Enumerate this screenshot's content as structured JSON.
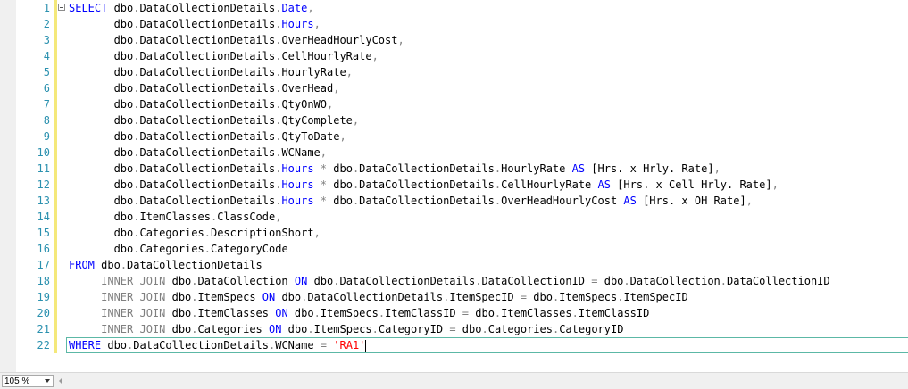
{
  "editor": {
    "lines": [
      {
        "n": "1",
        "tokens": [
          {
            "t": "SELECT",
            "c": "kw"
          },
          {
            "t": " dbo",
            "c": "id"
          },
          {
            "t": ".",
            "c": "op"
          },
          {
            "t": "DataCollectionDetails",
            "c": "id"
          },
          {
            "t": ".",
            "c": "op"
          },
          {
            "t": "Date",
            "c": "kw"
          },
          {
            "t": ",",
            "c": "op"
          }
        ]
      },
      {
        "n": "2",
        "tokens": [
          {
            "t": "       dbo",
            "c": "id"
          },
          {
            "t": ".",
            "c": "op"
          },
          {
            "t": "DataCollectionDetails",
            "c": "id"
          },
          {
            "t": ".",
            "c": "op"
          },
          {
            "t": "Hours",
            "c": "kw"
          },
          {
            "t": ",",
            "c": "op"
          }
        ]
      },
      {
        "n": "3",
        "tokens": [
          {
            "t": "       dbo",
            "c": "id"
          },
          {
            "t": ".",
            "c": "op"
          },
          {
            "t": "DataCollectionDetails",
            "c": "id"
          },
          {
            "t": ".",
            "c": "op"
          },
          {
            "t": "OverHeadHourlyCost",
            "c": "id"
          },
          {
            "t": ",",
            "c": "op"
          }
        ]
      },
      {
        "n": "4",
        "tokens": [
          {
            "t": "       dbo",
            "c": "id"
          },
          {
            "t": ".",
            "c": "op"
          },
          {
            "t": "DataCollectionDetails",
            "c": "id"
          },
          {
            "t": ".",
            "c": "op"
          },
          {
            "t": "CellHourlyRate",
            "c": "id"
          },
          {
            "t": ",",
            "c": "op"
          }
        ]
      },
      {
        "n": "5",
        "tokens": [
          {
            "t": "       dbo",
            "c": "id"
          },
          {
            "t": ".",
            "c": "op"
          },
          {
            "t": "DataCollectionDetails",
            "c": "id"
          },
          {
            "t": ".",
            "c": "op"
          },
          {
            "t": "HourlyRate",
            "c": "id"
          },
          {
            "t": ",",
            "c": "op"
          }
        ]
      },
      {
        "n": "6",
        "tokens": [
          {
            "t": "       dbo",
            "c": "id"
          },
          {
            "t": ".",
            "c": "op"
          },
          {
            "t": "DataCollectionDetails",
            "c": "id"
          },
          {
            "t": ".",
            "c": "op"
          },
          {
            "t": "OverHead",
            "c": "id"
          },
          {
            "t": ",",
            "c": "op"
          }
        ]
      },
      {
        "n": "7",
        "tokens": [
          {
            "t": "       dbo",
            "c": "id"
          },
          {
            "t": ".",
            "c": "op"
          },
          {
            "t": "DataCollectionDetails",
            "c": "id"
          },
          {
            "t": ".",
            "c": "op"
          },
          {
            "t": "QtyOnWO",
            "c": "id"
          },
          {
            "t": ",",
            "c": "op"
          }
        ]
      },
      {
        "n": "8",
        "tokens": [
          {
            "t": "       dbo",
            "c": "id"
          },
          {
            "t": ".",
            "c": "op"
          },
          {
            "t": "DataCollectionDetails",
            "c": "id"
          },
          {
            "t": ".",
            "c": "op"
          },
          {
            "t": "QtyComplete",
            "c": "id"
          },
          {
            "t": ",",
            "c": "op"
          }
        ]
      },
      {
        "n": "9",
        "tokens": [
          {
            "t": "       dbo",
            "c": "id"
          },
          {
            "t": ".",
            "c": "op"
          },
          {
            "t": "DataCollectionDetails",
            "c": "id"
          },
          {
            "t": ".",
            "c": "op"
          },
          {
            "t": "QtyToDate",
            "c": "id"
          },
          {
            "t": ",",
            "c": "op"
          }
        ]
      },
      {
        "n": "10",
        "tokens": [
          {
            "t": "       dbo",
            "c": "id"
          },
          {
            "t": ".",
            "c": "op"
          },
          {
            "t": "DataCollectionDetails",
            "c": "id"
          },
          {
            "t": ".",
            "c": "op"
          },
          {
            "t": "WCName",
            "c": "id"
          },
          {
            "t": ",",
            "c": "op"
          }
        ]
      },
      {
        "n": "11",
        "tokens": [
          {
            "t": "       dbo",
            "c": "id"
          },
          {
            "t": ".",
            "c": "op"
          },
          {
            "t": "DataCollectionDetails",
            "c": "id"
          },
          {
            "t": ".",
            "c": "op"
          },
          {
            "t": "Hours",
            "c": "kw"
          },
          {
            "t": " * ",
            "c": "op"
          },
          {
            "t": "dbo",
            "c": "id"
          },
          {
            "t": ".",
            "c": "op"
          },
          {
            "t": "DataCollectionDetails",
            "c": "id"
          },
          {
            "t": ".",
            "c": "op"
          },
          {
            "t": "HourlyRate ",
            "c": "id"
          },
          {
            "t": "AS",
            "c": "kw"
          },
          {
            "t": " [Hrs. x Hrly. Rate]",
            "c": "id"
          },
          {
            "t": ",",
            "c": "op"
          }
        ]
      },
      {
        "n": "12",
        "tokens": [
          {
            "t": "       dbo",
            "c": "id"
          },
          {
            "t": ".",
            "c": "op"
          },
          {
            "t": "DataCollectionDetails",
            "c": "id"
          },
          {
            "t": ".",
            "c": "op"
          },
          {
            "t": "Hours",
            "c": "kw"
          },
          {
            "t": " * ",
            "c": "op"
          },
          {
            "t": "dbo",
            "c": "id"
          },
          {
            "t": ".",
            "c": "op"
          },
          {
            "t": "DataCollectionDetails",
            "c": "id"
          },
          {
            "t": ".",
            "c": "op"
          },
          {
            "t": "CellHourlyRate ",
            "c": "id"
          },
          {
            "t": "AS",
            "c": "kw"
          },
          {
            "t": " [Hrs. x Cell Hrly. Rate]",
            "c": "id"
          },
          {
            "t": ",",
            "c": "op"
          }
        ]
      },
      {
        "n": "13",
        "tokens": [
          {
            "t": "       dbo",
            "c": "id"
          },
          {
            "t": ".",
            "c": "op"
          },
          {
            "t": "DataCollectionDetails",
            "c": "id"
          },
          {
            "t": ".",
            "c": "op"
          },
          {
            "t": "Hours",
            "c": "kw"
          },
          {
            "t": " * ",
            "c": "op"
          },
          {
            "t": "dbo",
            "c": "id"
          },
          {
            "t": ".",
            "c": "op"
          },
          {
            "t": "DataCollectionDetails",
            "c": "id"
          },
          {
            "t": ".",
            "c": "op"
          },
          {
            "t": "OverHeadHourlyCost ",
            "c": "id"
          },
          {
            "t": "AS",
            "c": "kw"
          },
          {
            "t": " [Hrs. x OH Rate]",
            "c": "id"
          },
          {
            "t": ",",
            "c": "op"
          }
        ]
      },
      {
        "n": "14",
        "tokens": [
          {
            "t": "       dbo",
            "c": "id"
          },
          {
            "t": ".",
            "c": "op"
          },
          {
            "t": "ItemClasses",
            "c": "id"
          },
          {
            "t": ".",
            "c": "op"
          },
          {
            "t": "ClassCode",
            "c": "id"
          },
          {
            "t": ",",
            "c": "op"
          }
        ]
      },
      {
        "n": "15",
        "tokens": [
          {
            "t": "       dbo",
            "c": "id"
          },
          {
            "t": ".",
            "c": "op"
          },
          {
            "t": "Categories",
            "c": "id"
          },
          {
            "t": ".",
            "c": "op"
          },
          {
            "t": "DescriptionShort",
            "c": "id"
          },
          {
            "t": ",",
            "c": "op"
          }
        ]
      },
      {
        "n": "16",
        "tokens": [
          {
            "t": "       dbo",
            "c": "id"
          },
          {
            "t": ".",
            "c": "op"
          },
          {
            "t": "Categories",
            "c": "id"
          },
          {
            "t": ".",
            "c": "op"
          },
          {
            "t": "CategoryCode",
            "c": "id"
          }
        ]
      },
      {
        "n": "17",
        "tokens": [
          {
            "t": "FROM",
            "c": "kw"
          },
          {
            "t": " dbo",
            "c": "id"
          },
          {
            "t": ".",
            "c": "op"
          },
          {
            "t": "DataCollectionDetails",
            "c": "id"
          }
        ]
      },
      {
        "n": "18",
        "tokens": [
          {
            "t": "     INNER JOIN",
            "c": "op"
          },
          {
            "t": " dbo",
            "c": "id"
          },
          {
            "t": ".",
            "c": "op"
          },
          {
            "t": "DataCollection ",
            "c": "id"
          },
          {
            "t": "ON",
            "c": "kw"
          },
          {
            "t": " dbo",
            "c": "id"
          },
          {
            "t": ".",
            "c": "op"
          },
          {
            "t": "DataCollectionDetails",
            "c": "id"
          },
          {
            "t": ".",
            "c": "op"
          },
          {
            "t": "DataCollectionID ",
            "c": "id"
          },
          {
            "t": "=",
            "c": "op"
          },
          {
            "t": " dbo",
            "c": "id"
          },
          {
            "t": ".",
            "c": "op"
          },
          {
            "t": "DataCollection",
            "c": "id"
          },
          {
            "t": ".",
            "c": "op"
          },
          {
            "t": "DataCollectionID",
            "c": "id"
          }
        ]
      },
      {
        "n": "19",
        "tokens": [
          {
            "t": "     INNER JOIN",
            "c": "op"
          },
          {
            "t": " dbo",
            "c": "id"
          },
          {
            "t": ".",
            "c": "op"
          },
          {
            "t": "ItemSpecs ",
            "c": "id"
          },
          {
            "t": "ON",
            "c": "kw"
          },
          {
            "t": " dbo",
            "c": "id"
          },
          {
            "t": ".",
            "c": "op"
          },
          {
            "t": "DataCollectionDetails",
            "c": "id"
          },
          {
            "t": ".",
            "c": "op"
          },
          {
            "t": "ItemSpecID ",
            "c": "id"
          },
          {
            "t": "=",
            "c": "op"
          },
          {
            "t": " dbo",
            "c": "id"
          },
          {
            "t": ".",
            "c": "op"
          },
          {
            "t": "ItemSpecs",
            "c": "id"
          },
          {
            "t": ".",
            "c": "op"
          },
          {
            "t": "ItemSpecID",
            "c": "id"
          }
        ]
      },
      {
        "n": "20",
        "tokens": [
          {
            "t": "     INNER JOIN",
            "c": "op"
          },
          {
            "t": " dbo",
            "c": "id"
          },
          {
            "t": ".",
            "c": "op"
          },
          {
            "t": "ItemClasses ",
            "c": "id"
          },
          {
            "t": "ON",
            "c": "kw"
          },
          {
            "t": " dbo",
            "c": "id"
          },
          {
            "t": ".",
            "c": "op"
          },
          {
            "t": "ItemSpecs",
            "c": "id"
          },
          {
            "t": ".",
            "c": "op"
          },
          {
            "t": "ItemClassID ",
            "c": "id"
          },
          {
            "t": "=",
            "c": "op"
          },
          {
            "t": " dbo",
            "c": "id"
          },
          {
            "t": ".",
            "c": "op"
          },
          {
            "t": "ItemClasses",
            "c": "id"
          },
          {
            "t": ".",
            "c": "op"
          },
          {
            "t": "ItemClassID",
            "c": "id"
          }
        ]
      },
      {
        "n": "21",
        "tokens": [
          {
            "t": "     INNER JOIN",
            "c": "op"
          },
          {
            "t": " dbo",
            "c": "id"
          },
          {
            "t": ".",
            "c": "op"
          },
          {
            "t": "Categories ",
            "c": "id"
          },
          {
            "t": "ON",
            "c": "kw"
          },
          {
            "t": " dbo",
            "c": "id"
          },
          {
            "t": ".",
            "c": "op"
          },
          {
            "t": "ItemSpecs",
            "c": "id"
          },
          {
            "t": ".",
            "c": "op"
          },
          {
            "t": "CategoryID ",
            "c": "id"
          },
          {
            "t": "=",
            "c": "op"
          },
          {
            "t": " dbo",
            "c": "id"
          },
          {
            "t": ".",
            "c": "op"
          },
          {
            "t": "Categories",
            "c": "id"
          },
          {
            "t": ".",
            "c": "op"
          },
          {
            "t": "CategoryID",
            "c": "id"
          }
        ]
      },
      {
        "n": "22",
        "tokens": [
          {
            "t": "WHERE",
            "c": "kw"
          },
          {
            "t": " dbo",
            "c": "id"
          },
          {
            "t": ".",
            "c": "op"
          },
          {
            "t": "DataCollectionDetails",
            "c": "id"
          },
          {
            "t": ".",
            "c": "op"
          },
          {
            "t": "WCName ",
            "c": "id"
          },
          {
            "t": "=",
            "c": "op"
          },
          {
            "t": " ",
            "c": "id"
          },
          {
            "t": "'RA1'",
            "c": "str"
          }
        ]
      }
    ],
    "current_line": "22"
  },
  "statusbar": {
    "zoom": "105 %"
  },
  "colors": {
    "keyword": "#0000ff",
    "operator": "#808080",
    "string": "#ff0000",
    "line_number": "#2b91af",
    "change_marker": "#f4e87a",
    "current_line_border": "#5cb8a6"
  },
  "icons": {
    "fold": "minus-box-icon",
    "zoom_dropdown": "chevron-down-icon",
    "scroll_left": "arrow-left-icon"
  }
}
